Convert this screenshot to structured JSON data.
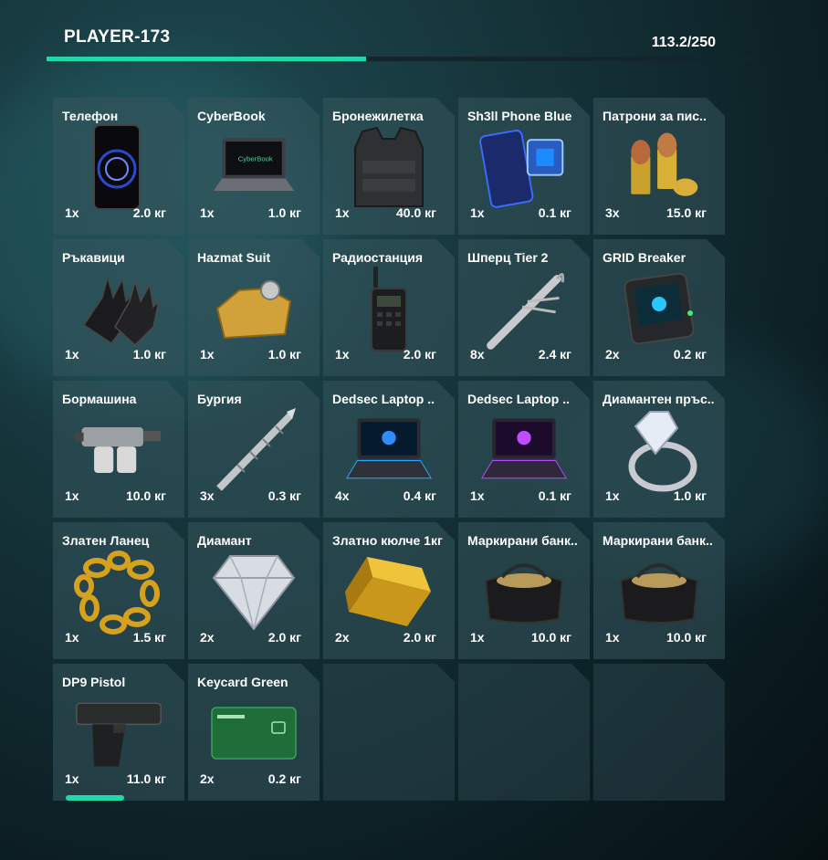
{
  "header": {
    "player": "PLAYER-173",
    "weight": "113.2/250",
    "capacity_fraction": 0.453
  },
  "colors": {
    "accent": "#1fd9a9"
  },
  "items": [
    {
      "name": "Телефон",
      "qty": "1x",
      "weight": "2.0 кг",
      "icon": "phone-icon"
    },
    {
      "name": "CyberBook",
      "qty": "1x",
      "weight": "1.0 кг",
      "icon": "laptop-icon"
    },
    {
      "name": "Бронежилетка",
      "qty": "1x",
      "weight": "40.0 кг",
      "icon": "armor-vest-icon"
    },
    {
      "name": "Sh3ll Phone Blue",
      "qty": "1x",
      "weight": "0.1 кг",
      "icon": "hacker-phone-icon"
    },
    {
      "name": "Патрони за пис..",
      "qty": "3x",
      "weight": "15.0 кг",
      "icon": "ammo-icon"
    },
    {
      "name": "Ръкавици",
      "qty": "1x",
      "weight": "1.0 кг",
      "icon": "gloves-icon"
    },
    {
      "name": "Hazmat Suit",
      "qty": "1x",
      "weight": "1.0 кг",
      "icon": "hazmat-suit-icon"
    },
    {
      "name": "Радиостанция",
      "qty": "1x",
      "weight": "2.0 кг",
      "icon": "radio-icon"
    },
    {
      "name": "Шперц Tier 2",
      "qty": "8x",
      "weight": "2.4 кг",
      "icon": "lockpick-icon"
    },
    {
      "name": "GRID Breaker",
      "qty": "2x",
      "weight": "0.2 кг",
      "icon": "grid-breaker-icon"
    },
    {
      "name": "Бормашина",
      "qty": "1x",
      "weight": "10.0 кг",
      "icon": "drill-icon"
    },
    {
      "name": "Бургия",
      "qty": "3x",
      "weight": "0.3 кг",
      "icon": "drill-bit-icon"
    },
    {
      "name": "Dedsec Laptop ..",
      "qty": "4x",
      "weight": "0.4 кг",
      "icon": "dedsec-laptop-blue-icon"
    },
    {
      "name": "Dedsec Laptop ..",
      "qty": "1x",
      "weight": "0.1 кг",
      "icon": "dedsec-laptop-purple-icon"
    },
    {
      "name": "Диамантен пръс..",
      "qty": "1x",
      "weight": "1.0 кг",
      "icon": "diamond-ring-icon"
    },
    {
      "name": "Златен Ланец",
      "qty": "1x",
      "weight": "1.5 кг",
      "icon": "gold-chain-icon"
    },
    {
      "name": "Диамант",
      "qty": "2x",
      "weight": "2.0 кг",
      "icon": "diamond-icon"
    },
    {
      "name": "Златно кюлче 1кг",
      "qty": "2x",
      "weight": "2.0 кг",
      "icon": "gold-bar-icon"
    },
    {
      "name": "Маркирани банк..",
      "qty": "1x",
      "weight": "10.0 кг",
      "icon": "money-bag-icon"
    },
    {
      "name": "Маркирани банк..",
      "qty": "1x",
      "weight": "10.0 кг",
      "icon": "money-bag-icon"
    },
    {
      "name": "DP9 Pistol",
      "qty": "1x",
      "weight": "11.0 кг",
      "icon": "pistol-icon"
    },
    {
      "name": "Keycard Green",
      "qty": "2x",
      "weight": "0.2 кг",
      "icon": "keycard-icon"
    }
  ],
  "empty_slots": 3
}
